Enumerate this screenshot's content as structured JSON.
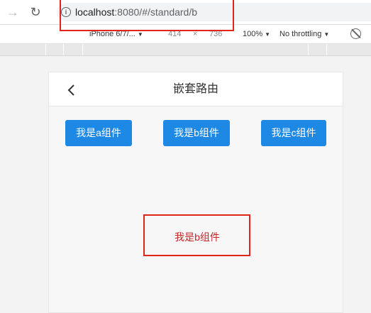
{
  "browser": {
    "url_host": "localhost",
    "url_rest": ":8080/#/standard/b",
    "device_toolbar": {
      "device": "iPhone 6/7/...",
      "width": "414",
      "times": "×",
      "height": "736",
      "zoom": "100%",
      "throttling": "No throttling"
    }
  },
  "app": {
    "title": "嵌套路由",
    "buttons": [
      "我是a组件",
      "我是b组件",
      "我是c组件"
    ],
    "child_content": "我是b组件"
  },
  "colors": {
    "button_bg": "#1e88e5",
    "child_text": "#c62828",
    "highlight_box": "#e0261b"
  }
}
